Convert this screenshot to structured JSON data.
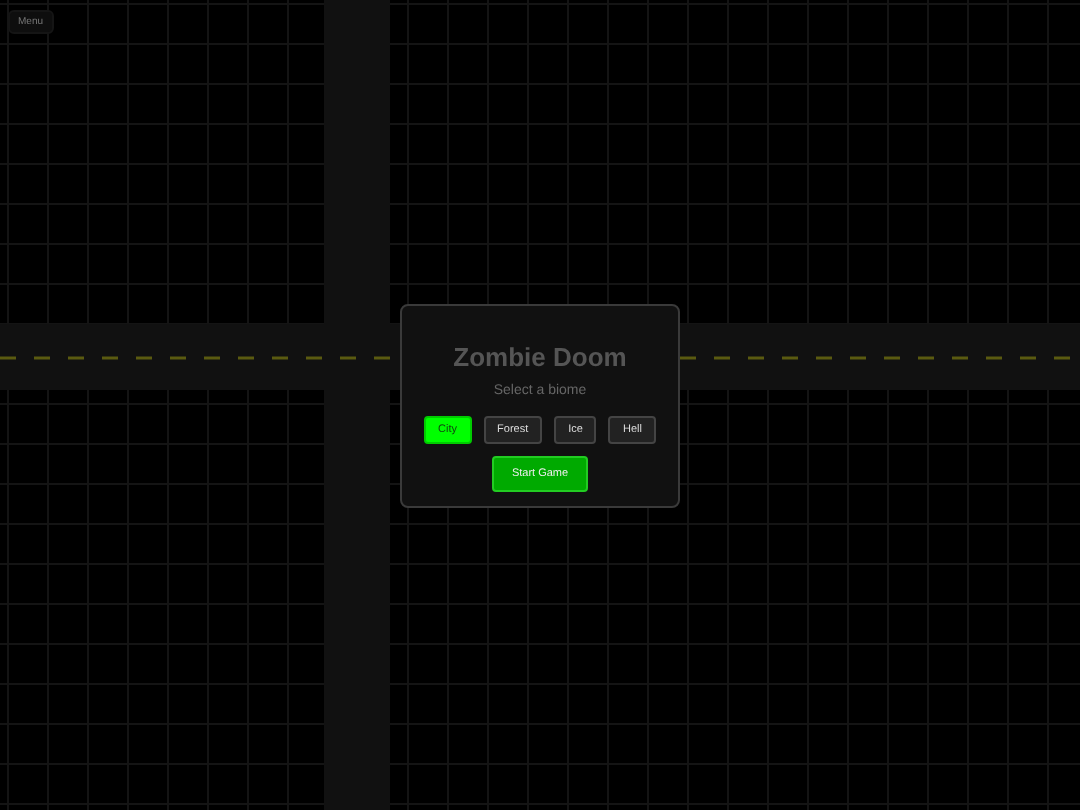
{
  "menu_button": "Menu",
  "dialog": {
    "title": "Zombie Doom",
    "subtitle": "Select a biome",
    "biomes": [
      {
        "label": "City",
        "selected": true
      },
      {
        "label": "Forest",
        "selected": false
      },
      {
        "label": "Ice",
        "selected": false
      },
      {
        "label": "Hell",
        "selected": false
      }
    ],
    "start_button": "Start Game"
  }
}
